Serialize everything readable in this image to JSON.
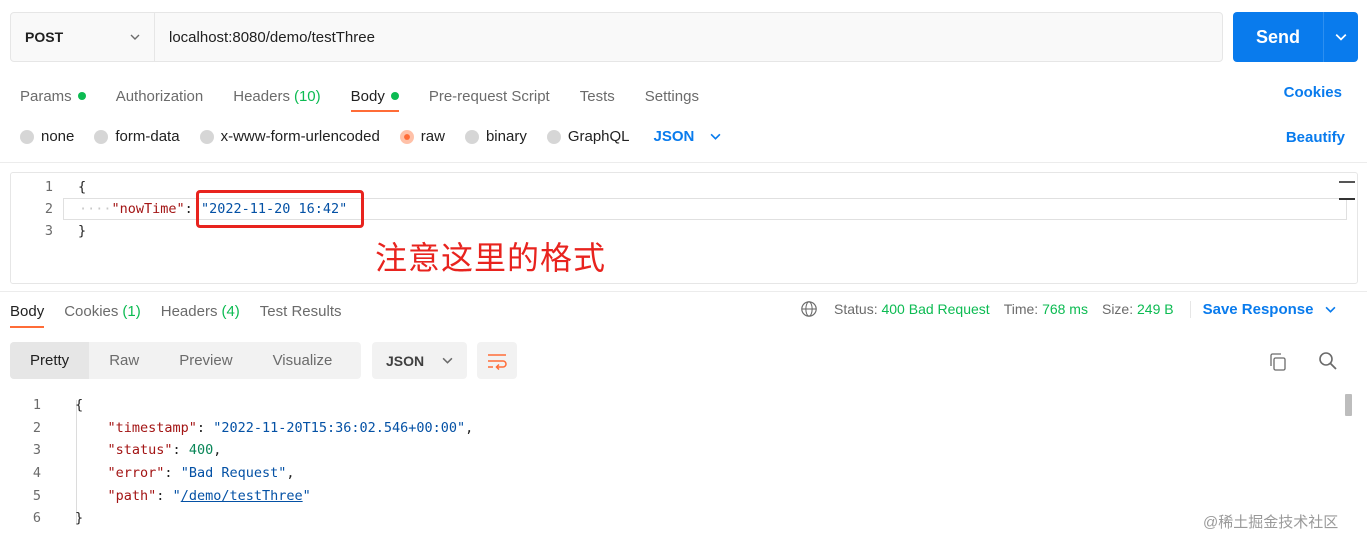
{
  "request": {
    "method": "POST",
    "url": "localhost:8080/demo/testThree",
    "send_label": "Send"
  },
  "req_tabs": [
    {
      "label": "Params",
      "dot": true
    },
    {
      "label": "Authorization"
    },
    {
      "label": "Headers",
      "count": "(10)"
    },
    {
      "label": "Body",
      "dot": true,
      "active": true
    },
    {
      "label": "Pre-request Script"
    },
    {
      "label": "Tests"
    },
    {
      "label": "Settings"
    }
  ],
  "cookies_label": "Cookies",
  "body_types": [
    "none",
    "form-data",
    "x-www-form-urlencoded",
    "raw",
    "binary",
    "GraphQL"
  ],
  "body_type_selected": "raw",
  "body_format": "JSON",
  "beautify_label": "Beautify",
  "request_body": {
    "line_numbers": [
      "1",
      "2",
      "3"
    ],
    "open_brace": "{",
    "close_brace": "}",
    "key": "\"nowTime\"",
    "colon": ": ",
    "value": "\"2022-11-20 16:42\""
  },
  "annotation": "注意这里的格式",
  "res_tabs": [
    {
      "label": "Body",
      "active": true
    },
    {
      "label": "Cookies",
      "count": "(1)"
    },
    {
      "label": "Headers",
      "count": "(4)"
    },
    {
      "label": "Test Results"
    }
  ],
  "status": {
    "status_label": "Status:",
    "status_value": "400 Bad Request",
    "time_label": "Time:",
    "time_value": "768 ms",
    "size_label": "Size:",
    "size_value": "249 B",
    "save_label": "Save Response"
  },
  "view_options": [
    "Pretty",
    "Raw",
    "Preview",
    "Visualize"
  ],
  "response_format": "JSON",
  "response_body": {
    "line_numbers": [
      "1",
      "2",
      "3",
      "4",
      "5",
      "6"
    ],
    "open_brace": "{",
    "close_brace": "}",
    "timestamp_key": "\"timestamp\"",
    "timestamp_value": "\"2022-11-20T15:36:02.546+00:00\"",
    "status_key": "\"status\"",
    "status_value": "400",
    "error_key": "\"error\"",
    "error_value": "\"Bad Request\"",
    "path_key": "\"path\"",
    "path_value_open": "\"",
    "path_value": "/demo/testThree",
    "path_value_close": "\""
  },
  "watermark": "@稀土掘金技术社区",
  "colors": {
    "accent": "#097bed",
    "tab_underline": "#ff6c37",
    "success_green": "#0cbb52",
    "annotation_red": "#e8231e"
  }
}
